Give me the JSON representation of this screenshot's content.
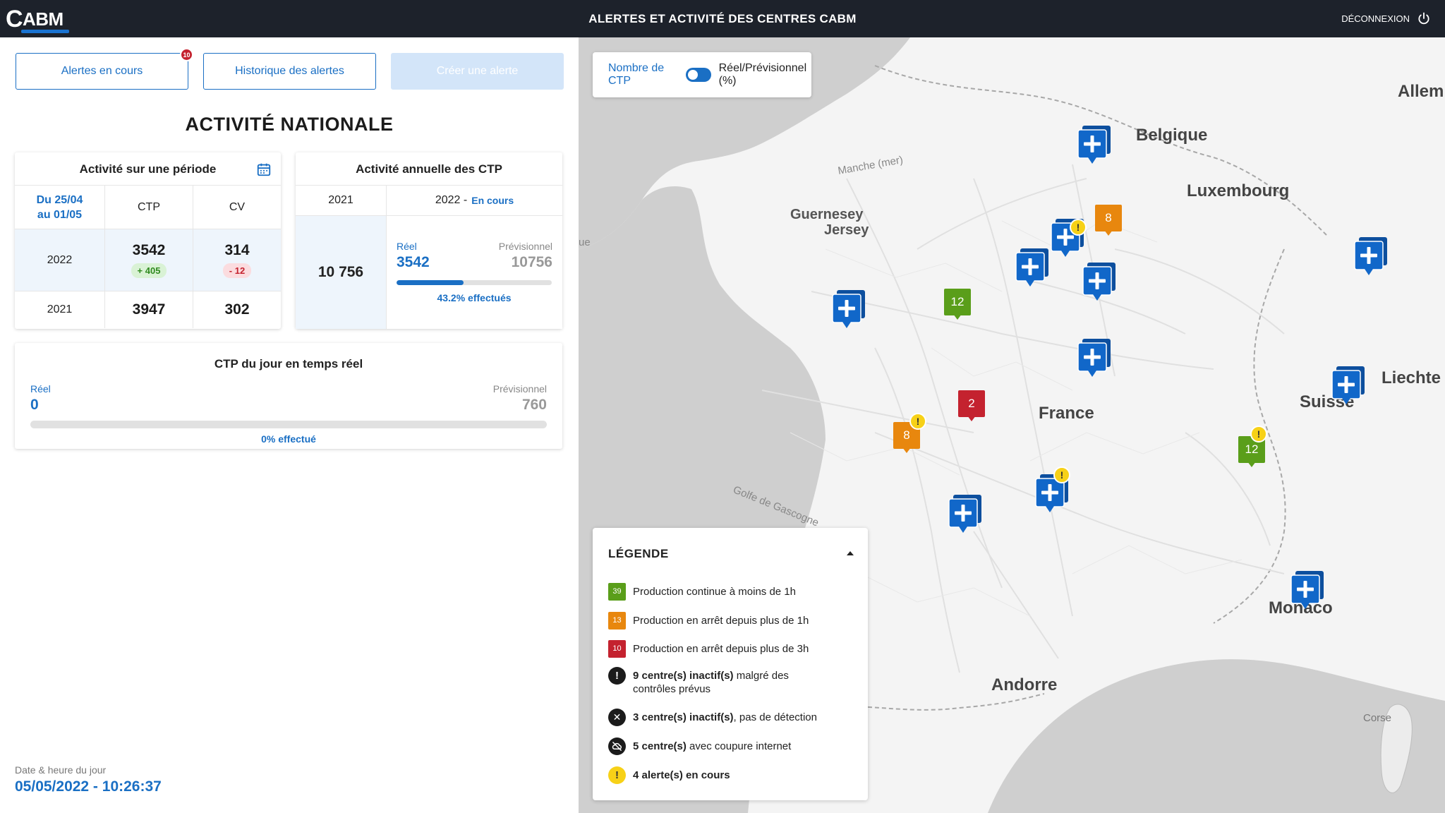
{
  "header": {
    "logo_c": "C",
    "logo_text": "ABM",
    "title": "ALERTES ET ACTIVITÉ DES CENTRES CABM",
    "logout_label": "DÉCONNEXION"
  },
  "buttons": {
    "alerts_current": "Alertes en cours",
    "alerts_current_badge": "10",
    "alerts_history": "Historique des alertes",
    "create_alert": "Créer une alerte"
  },
  "national": {
    "title": "ACTIVITÉ NATIONALE"
  },
  "period_card": {
    "title": "Activité sur une période",
    "period_line1": "Du 25/04",
    "period_line2": "au 01/05",
    "col_ctp": "CTP",
    "col_cv": "CV",
    "rows": [
      {
        "year": "2022",
        "ctp": "3542",
        "ctp_delta": "+ 405",
        "cv": "314",
        "cv_delta": "- 12"
      },
      {
        "year": "2021",
        "ctp": "3947",
        "cv": "302"
      }
    ]
  },
  "annual_card": {
    "title": "Activité annuelle des CTP",
    "year_prev": "2021",
    "year_curr": "2022 -",
    "year_curr_status": "En cours",
    "prev_value": "10 756",
    "reel_label": "Réel",
    "reel_value": "3542",
    "prev_label": "Prévisionnel",
    "prev_forecast": "10756",
    "progress_pct": 43.2,
    "progress_text": "43.2% effectués"
  },
  "realtime_card": {
    "title": "CTP du jour en temps réel",
    "reel_label": "Réel",
    "reel_value": "0",
    "prev_label": "Prévisionnel",
    "prev_value": "760",
    "progress_pct": 0,
    "progress_text": "0% effectué"
  },
  "footer": {
    "datetime_label": "Date & heure du jour",
    "datetime_value": "05/05/2022 - 10:26:37"
  },
  "map": {
    "toggle_left": "Nombre de CTP",
    "toggle_right": "Réel/Prévisionnel (%)",
    "labels": {
      "belgique": "Belgique",
      "luxembourg": "Luxembourg",
      "allemagne": "Allem",
      "guernesey": "Guernesey",
      "jersey": "Jersey",
      "manche": "Manche (mer)",
      "france": "France",
      "suisse": "Suisse",
      "liechtenstein": "Liechte",
      "golfe": "Golfe de Gascogne",
      "andorre": "Andorre",
      "monaco": "Monaco",
      "corse": "Corse",
      "que": "ue"
    },
    "num_markers": [
      {
        "value": "8",
        "color": "#e8870e"
      },
      {
        "value": "12",
        "color": "#5a9e1a"
      },
      {
        "value": "2",
        "color": "#c4222f"
      },
      {
        "value": "8",
        "color": "#e8870e"
      },
      {
        "value": "12",
        "color": "#5a9e1a"
      }
    ],
    "colors": {
      "blue_marker": "#1167c9",
      "alert_yellow": "#f7d117"
    }
  },
  "legend": {
    "title": "LÉGENDE",
    "items": [
      {
        "badge": "39",
        "color": "#5a9e1a",
        "text": "Production continue à moins de 1h"
      },
      {
        "badge": "13",
        "color": "#e8870e",
        "text": "Production en arrêt depuis plus de 1h"
      },
      {
        "badge": "10",
        "color": "#c4222f",
        "text": "Production en arrêt depuis plus de 3h"
      },
      {
        "bold": "9 centre(s) inactif(s)",
        "text": " malgré des contrôles prévus",
        "icon": "exclamation-circle-icon"
      },
      {
        "bold": "3 centre(s) inactif(s)",
        "text": ", pas de détection",
        "icon": "x-circle-icon"
      },
      {
        "bold": "5 centre(s)",
        "text": " avec coupure internet",
        "icon": "cloud-off-icon"
      },
      {
        "bold": "4 alerte(s) en cours",
        "text": "",
        "icon": "alert-yellow-icon"
      }
    ]
  }
}
